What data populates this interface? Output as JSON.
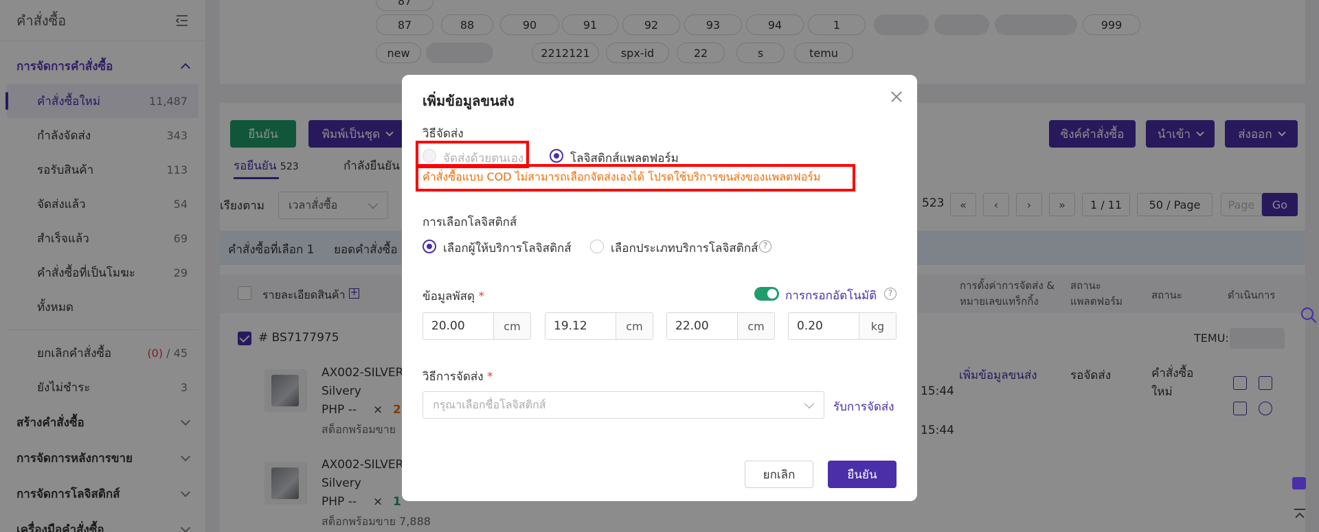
{
  "sidebar": {
    "header": "คำสั่งซื้อ",
    "order_mgmt": "การจัดการคำสั่งซื้อ",
    "items": [
      {
        "label": "คำสั่งซื้อใหม่",
        "count": "11,487"
      },
      {
        "label": "กำลังจัดส่ง",
        "count": "343"
      },
      {
        "label": "รอรับสินค้า",
        "count": "113"
      },
      {
        "label": "จัดส่งแล้ว",
        "count": "54"
      },
      {
        "label": "สำเร็จแล้ว",
        "count": "69"
      },
      {
        "label": "คำสั่งซื้อที่เป็นโมฆะ",
        "count": "29"
      },
      {
        "label": "ทั้งหมด",
        "count": ""
      }
    ],
    "cancel": {
      "label": "ยกเลิกคำสั่งซื้อ",
      "red": "(0)",
      "sep": "/",
      "total": "45"
    },
    "unpaid": {
      "label": "ยังไม่ชำระ",
      "count": "3"
    },
    "groups": [
      "สร้างคำสั่งซื้อ",
      "การจัดการหลังการขาย",
      "การจัดการโลจิสติกส์",
      "เครื่องมือคำสั่งซื้อ"
    ]
  },
  "tags": {
    "row1": [
      "87",
      "88",
      "90",
      "91",
      "92",
      "93",
      "94",
      "1",
      "999"
    ],
    "row2": [
      "new",
      "2212121",
      "spx-id",
      "22",
      "s",
      "temu"
    ]
  },
  "toolbar": {
    "confirm": "ยืนยัน",
    "batch_print": "พิมพ์เป็นชุด",
    "sync": "ซิงค์คำสั่งซื้อ",
    "import": "นำเข้า",
    "export": "ส่งออก"
  },
  "tabs": {
    "pending": "รอยืนยัน",
    "pending_count": "523",
    "confirming": "กำลังยืนยัน"
  },
  "sort": {
    "label": "เรียงตาม",
    "value": "เวลาสั่งซื้อ"
  },
  "pagination": {
    "total": "523",
    "page": "1 / 11",
    "per_page": "50 / Page",
    "page_placeholder": "Page",
    "go": "Go"
  },
  "selection": {
    "selected": "คำสั่งซื้อที่เลือก 1",
    "amount": "ยอดคำสั่งซื้อ"
  },
  "table": {
    "headers": [
      "รายละเอียดสินค้า",
      "การตั้งค่าการจัดส่ง & หมายเลขแทร็กกิ้ง",
      "สถานะ แพลตฟอร์ม",
      "สถานะ",
      "ดำเนินการ"
    ],
    "order_no": "# BS7177975",
    "store": "TEMU:",
    "items": [
      {
        "name": "AX002-SILVER",
        "variant": "Silvery",
        "price": "PHP --",
        "x": "×",
        "qty": "2",
        "stock": "สต็อกพร้อมขาย"
      },
      {
        "name": "AX002-SILVER",
        "variant": "Silvery",
        "price": "PHP --",
        "x": "×",
        "qty": "1",
        "stock": "สต็อกพร้อมขาย 7,888"
      }
    ],
    "times": [
      "15:44",
      "15:44"
    ],
    "add_shipping": "เพิ่มข้อมูลขนส่ง",
    "platform_status": "รอจัดส่ง",
    "status": "คำสั่งซื้อใหม่"
  },
  "modal": {
    "title": "เพิ่มข้อมูลขนส่ง",
    "ship_method_label": "วิธีจัดส่ง",
    "self_ship": "จัดส่งด้วยตนเอง",
    "platform_logistics": "โลจิสติกส์แพลตฟอร์ม",
    "cod_warning": "คำสั่งซื้อแบบ COD ไม่สามารถเลือกจัดส่งเองได้ โปรดใช้บริการขนส่งของแพลตฟอร์ม",
    "logistics_choice_label": "การเลือกโลจิสติกส์",
    "choose_provider": "เลือกผู้ให้บริการโลจิสติกส์",
    "choose_type": "เลือกประเภทบริการโลจิสติกส์",
    "parcel_label": "ข้อมูลพัสดุ",
    "required": "*",
    "autofill": "การกรอกอัตโนมัติ",
    "dims": [
      {
        "value": "20.00",
        "unit": "cm"
      },
      {
        "value": "19.12",
        "unit": "cm"
      },
      {
        "value": "22.00",
        "unit": "cm"
      },
      {
        "value": "0.20",
        "unit": "kg"
      }
    ],
    "shipping_method_label": "วิธีการจัดส่ง",
    "logistics_placeholder": "กรุณาเลือกชื่อโลจิสติกส์",
    "pickup_link": "รับการจัดส่ง",
    "cancel": "ยกเลิก",
    "confirm": "ยืนยัน"
  },
  "colors": {
    "accent": "#4a2fa8",
    "green": "#1f9d6b",
    "warning": "#f26a00",
    "highlight": "#ff0000"
  }
}
